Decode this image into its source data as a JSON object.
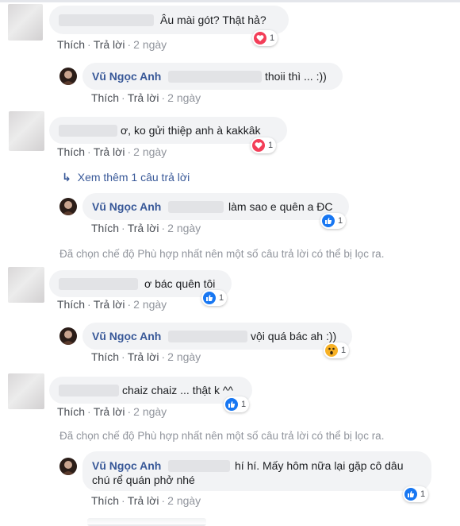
{
  "actions": {
    "like": "Thích",
    "reply": "Trả lời",
    "sep": "·"
  },
  "comments": [
    {
      "text": "Âu mài gót? Thật hả?",
      "time": "2 ngày",
      "reaction": {
        "type": "love",
        "count": "1"
      }
    },
    {
      "author": "Vũ Ngọc Anh",
      "text": "thoii thì ... :))",
      "time": "2 ngày"
    },
    {
      "text": "ơ, ko gửi thiệp anh à kakkâk",
      "time": "2 ngày",
      "reaction": {
        "type": "love",
        "count": "1"
      }
    },
    {
      "author": "Vũ Ngọc Anh",
      "text": "làm sao e quên a ĐC",
      "time": "2 ngày",
      "reaction": {
        "type": "like",
        "count": "1"
      }
    },
    {
      "text": "ơ bác quên tôi",
      "time": "2 ngày",
      "reaction": {
        "type": "like",
        "count": "1"
      }
    },
    {
      "author": "Vũ Ngọc Anh",
      "text": "vội quá bác ah :))",
      "time": "2 ngày",
      "reaction": {
        "type": "wow",
        "count": "1"
      }
    },
    {
      "text": "chaiz chaiz ... thật k ^^",
      "time": "2 ngày",
      "reaction": {
        "type": "like",
        "count": "1"
      }
    },
    {
      "author": "Vũ Ngọc Anh",
      "text_line1": "hí hí. Mấy hôm nữa lại gặp cô dâu",
      "text_line2": "chú rể quán phở nhé",
      "time": "2 ngày",
      "reaction": {
        "type": "like",
        "count": "1"
      }
    }
  ],
  "see_more": "Xem thêm 1 câu trả lời",
  "filtered_notice": "Đã chọn chế độ Phù hợp nhất nên một số câu trả lời có thể bị lọc ra.",
  "colors": {
    "link": "#385898",
    "bubble": "#f2f3f5",
    "love": "#f33e58",
    "like": "#1877f2",
    "wow": "#f7b125"
  }
}
